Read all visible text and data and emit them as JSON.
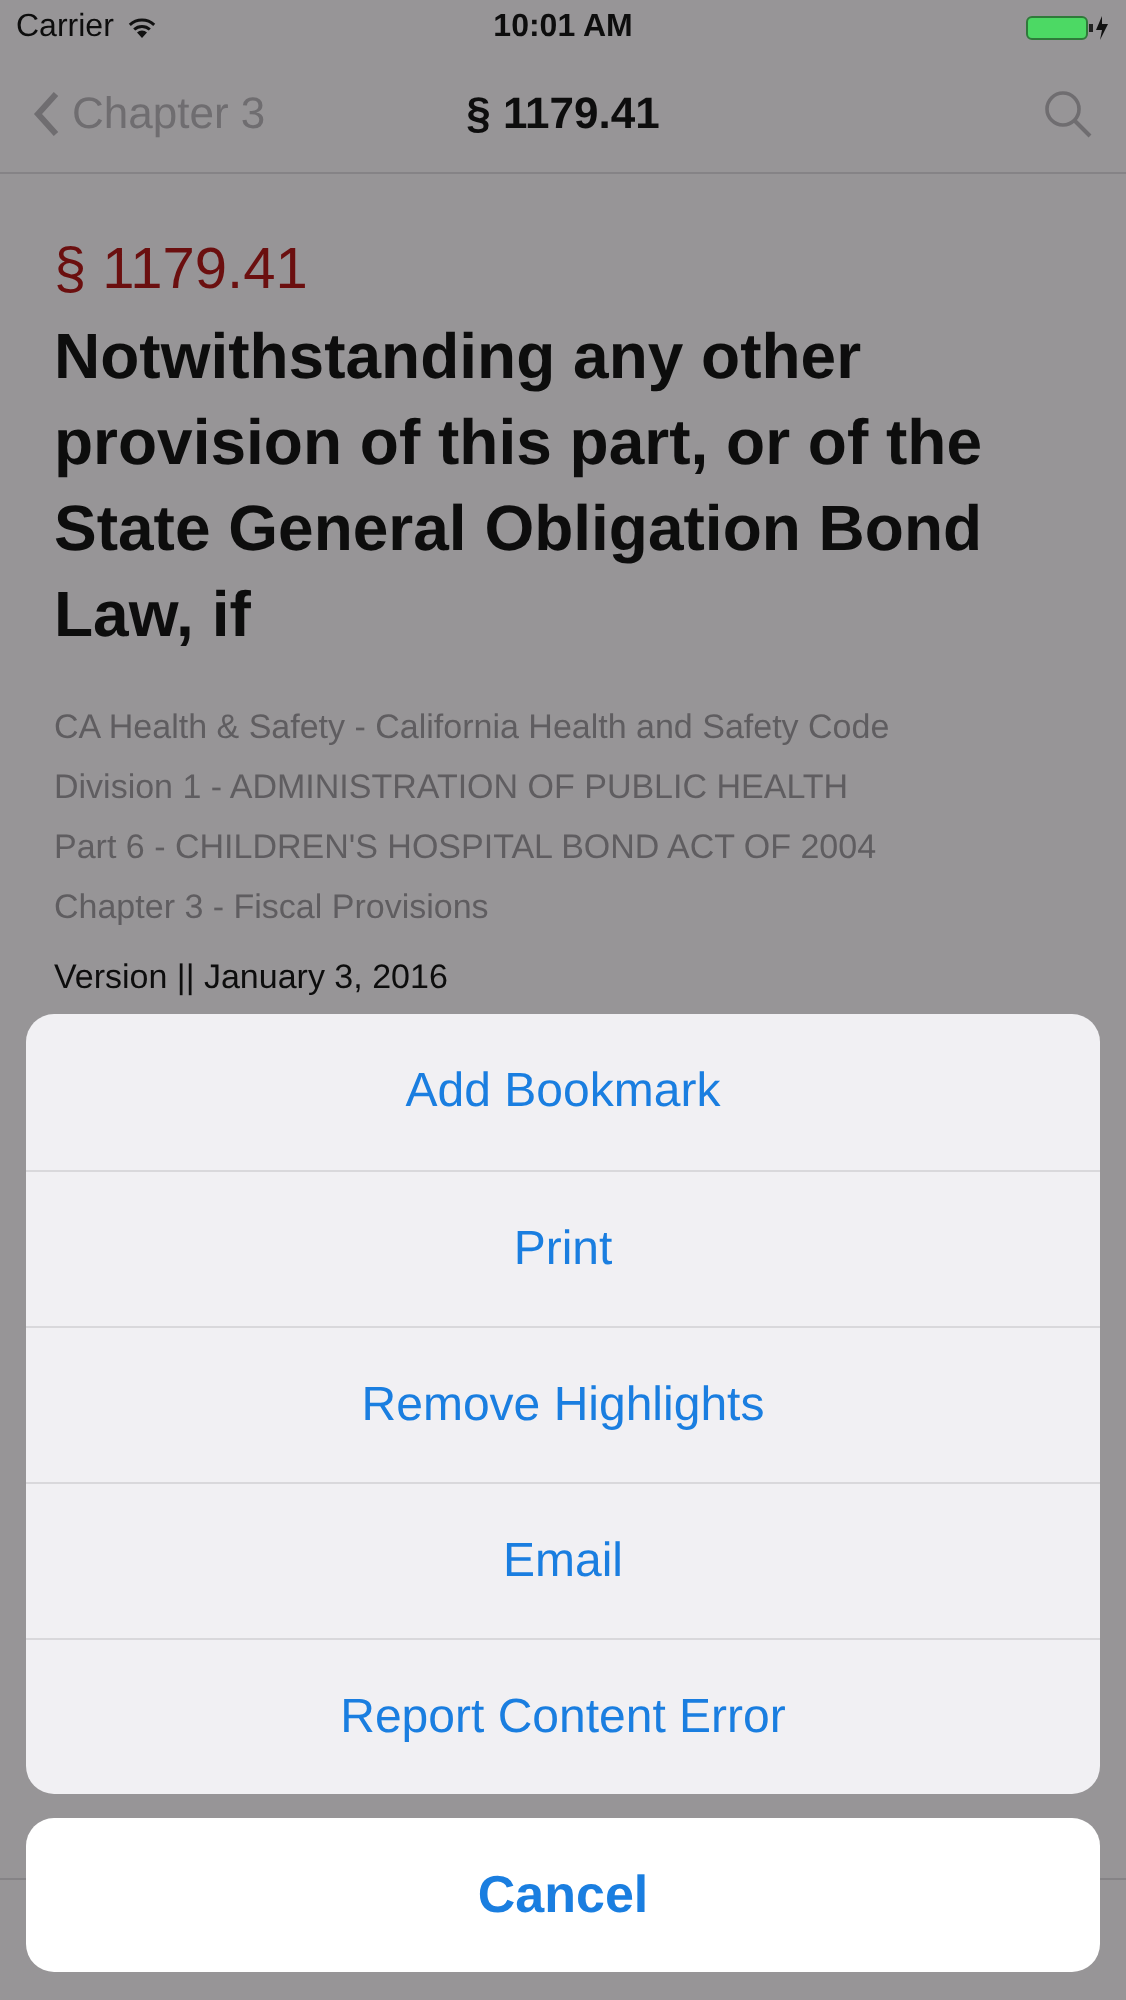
{
  "status_bar": {
    "carrier": "Carrier",
    "time": "10:01 AM"
  },
  "nav_bar": {
    "back_label": "Chapter 3",
    "title": "§ 1179.41"
  },
  "section": {
    "number": "§ 1179.41",
    "heading": "Notwithstanding any other provision of this part, or of the State General Obligation Bond Law, if",
    "breadcrumbs": [
      "CA Health & Safety - California Health and Safety Code",
      "Division 1 - ADMINISTRATION OF PUBLIC HEALTH",
      "Part 6 - CHILDREN'S HOSPITAL BOND ACT OF 2004",
      "Chapter 3 - Fiscal Provisions"
    ],
    "version": "Version || January 3, 2016"
  },
  "action_sheet": {
    "actions": [
      "Add Bookmark",
      "Print",
      "Remove Highlights",
      "Email",
      "Report Content Error"
    ],
    "cancel": "Cancel"
  }
}
